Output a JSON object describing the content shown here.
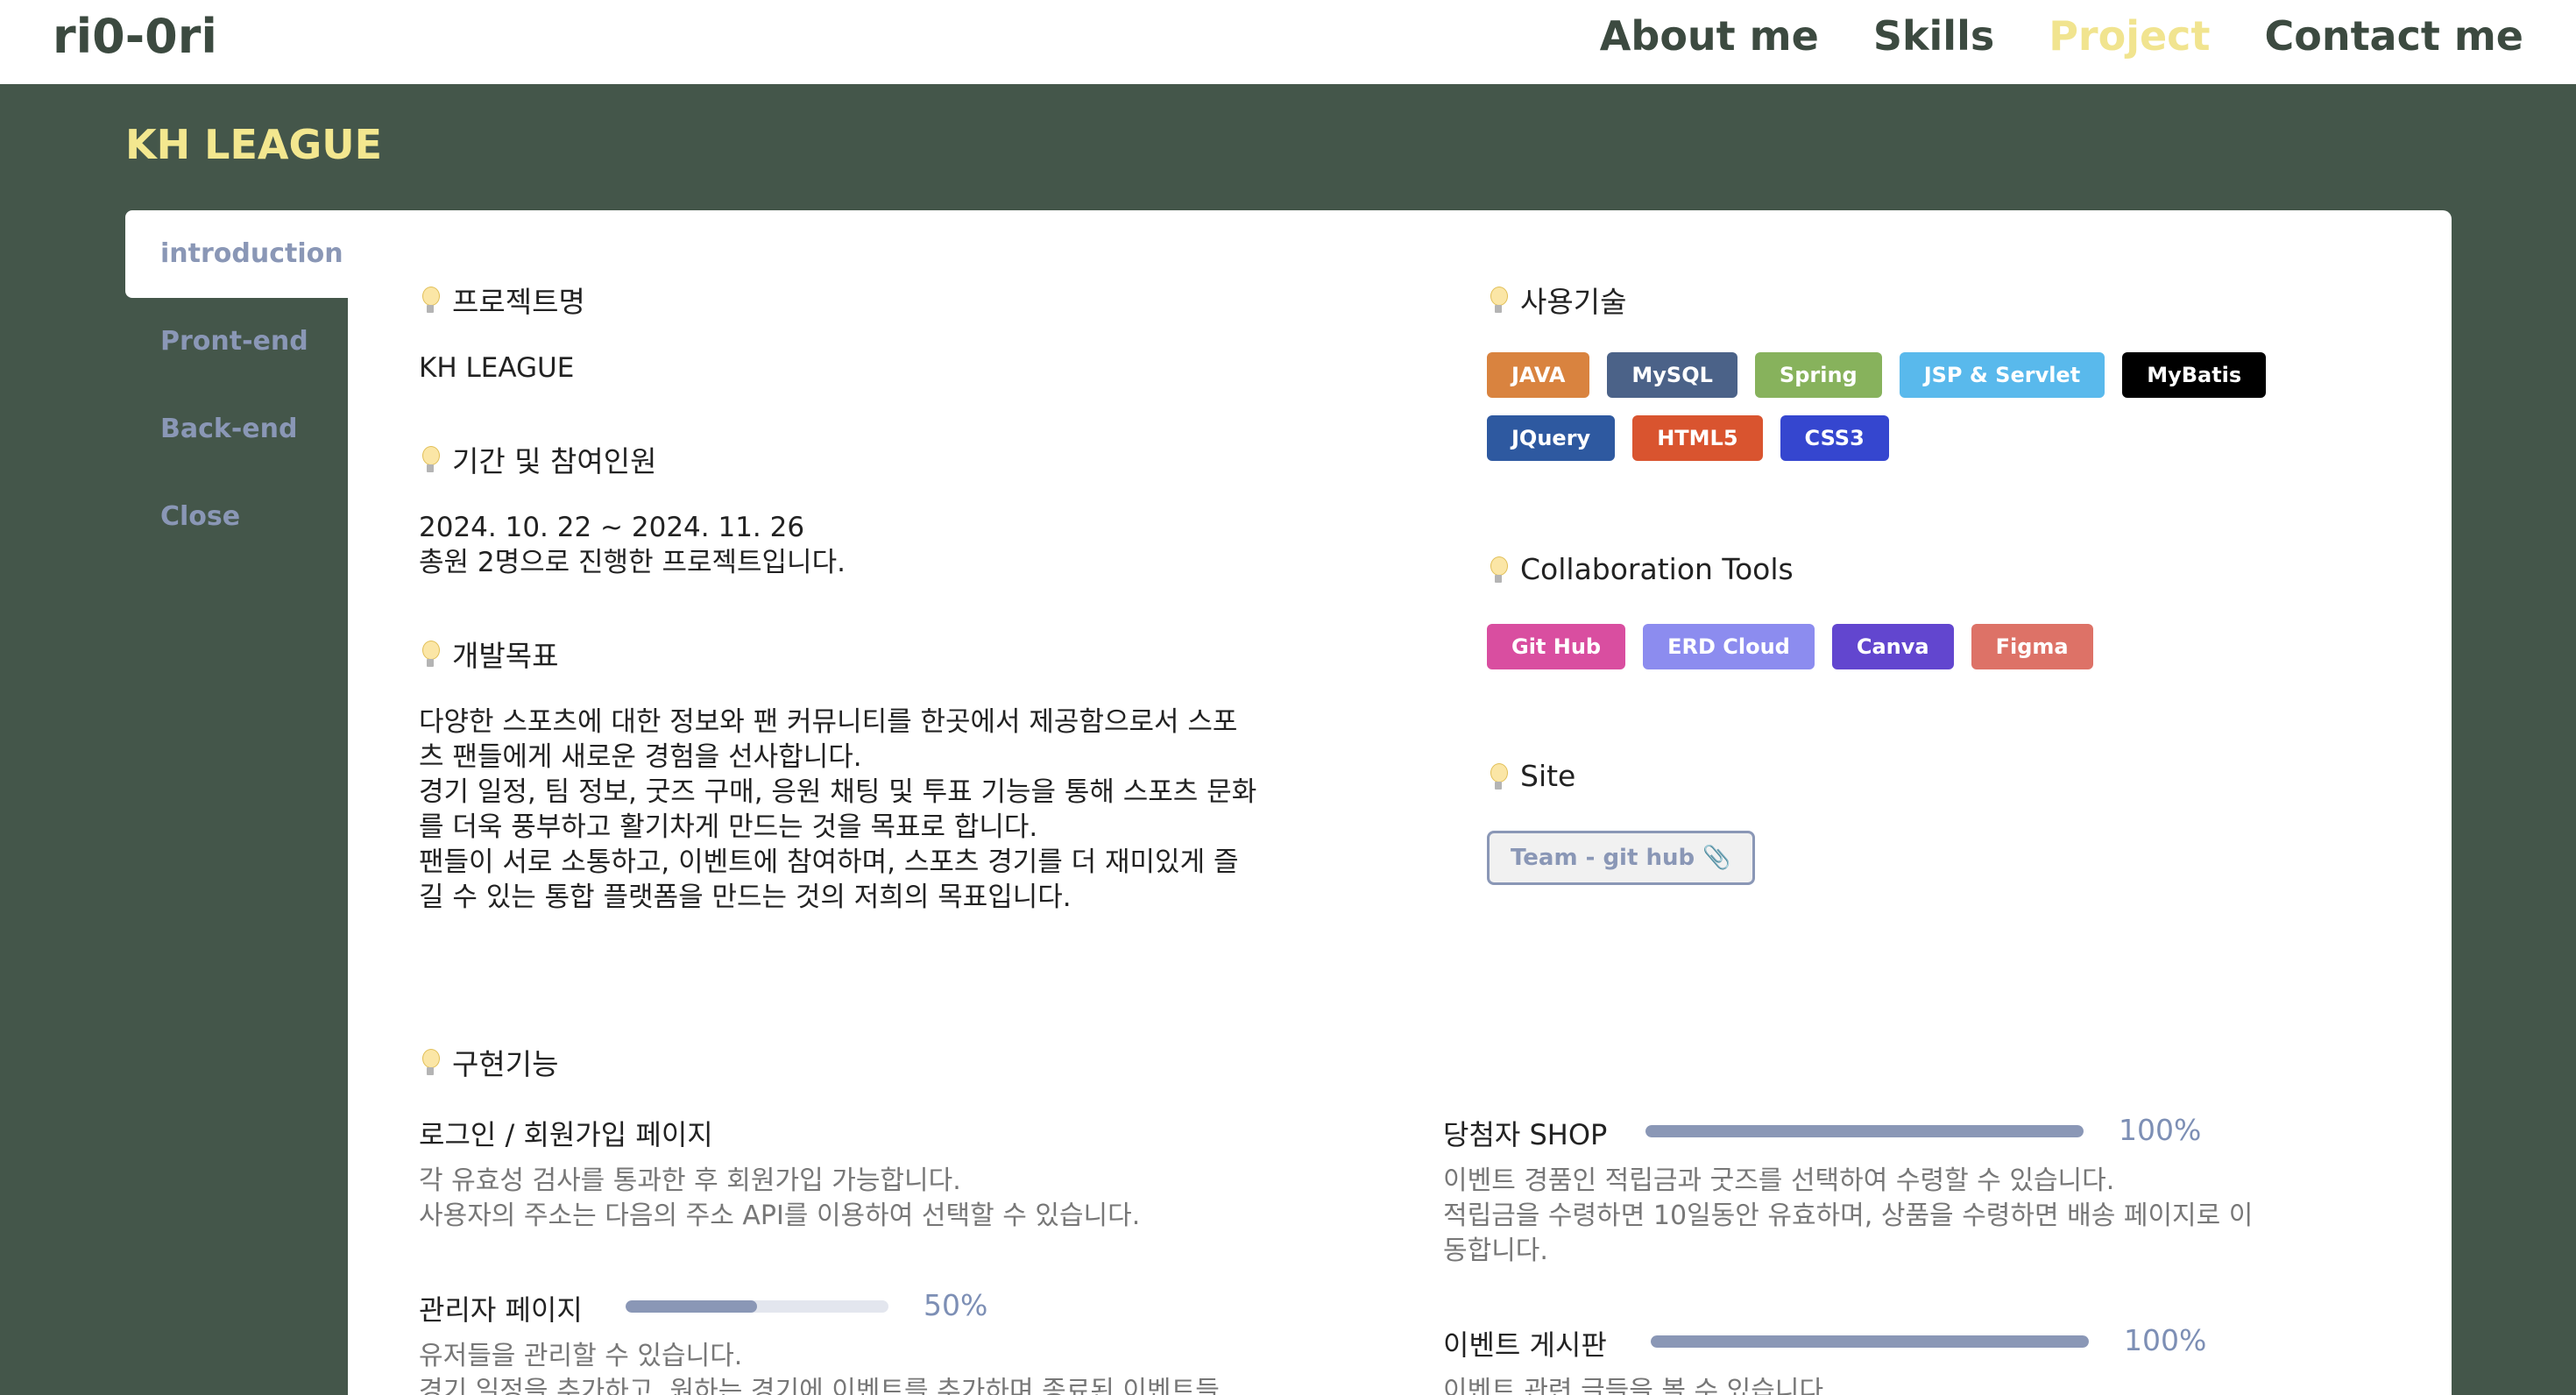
{
  "header": {
    "logo": "ri0-0ri",
    "nav": [
      "About me",
      "Skills",
      "Project",
      "Contact me"
    ],
    "active_nav": "Project"
  },
  "section": {
    "title": "KH LEAGUE"
  },
  "sidebar": {
    "items": [
      "introduction",
      "Pront-end",
      "Back-end",
      "Close"
    ],
    "active": "introduction"
  },
  "intro": {
    "project_name_heading": "프로젝트명",
    "project_name": "KH LEAGUE",
    "period_heading": "기간 및 참여인원",
    "period_text": "2024. 10. 22 ~ 2024. 11. 26\n총원 2명으로 진행한 프로젝트입니다.",
    "goal_heading": "개발목표",
    "goal_text": "다양한 스포츠에 대한 정보와 팬 커뮤니티를 한곳에서 제공함으로서 스포\n츠 팬들에게 새로운 경험을 선사합니다.\n경기 일정, 팀 정보, 굿즈 구매, 응원 채팅 및 투표 기능을 통해 스포츠 문화\n를 더욱 풍부하고 활기차게 만드는 것을 목표로 합니다.\n팬들이 서로 소통하고, 이벤트에 참여하며, 스포츠 경기를 더 재미있게 즐\n길 수 있는 통합 플랫폼을 만드는 것의 저희의 목표입니다."
  },
  "tech": {
    "heading": "사용기술",
    "badges": [
      {
        "label": "JAVA",
        "color": "#d9833f"
      },
      {
        "label": "MySQL",
        "color": "#4b6288"
      },
      {
        "label": "Spring",
        "color": "#87b25c"
      },
      {
        "label": "JSP & Servlet",
        "color": "#59b9ec"
      },
      {
        "label": "MyBatis",
        "color": "#000000"
      },
      {
        "label": "JQuery",
        "color": "#2e59a0"
      },
      {
        "label": "HTML5",
        "color": "#d9542f"
      },
      {
        "label": "CSS3",
        "color": "#3546cf"
      }
    ]
  },
  "collab": {
    "heading": "Collaboration Tools",
    "badges": [
      {
        "label": "Git Hub",
        "color": "#d94ea0"
      },
      {
        "label": "ERD Cloud",
        "color": "#8c8cef"
      },
      {
        "label": "Canva",
        "color": "#6246cf"
      },
      {
        "label": "Figma",
        "color": "#dd7267"
      }
    ]
  },
  "site": {
    "heading": "Site",
    "button_label": "Team - git hub 📎"
  },
  "features": {
    "heading": "구현기능",
    "items": [
      {
        "title": "로그인 / 회원가입 페이지",
        "description": "각 유효성 검사를 통과한 후 회원가입 가능합니다.\n사용자의 주소는 다음의 주소 API를 이용하여 선택할 수 있습니다."
      },
      {
        "title": "당첨자 SHOP",
        "progress": "100%",
        "progress_value": 1.0,
        "description": "이벤트 경품인 적립금과 굿즈를 선택하여 수령할 수 있습니다.\n적립금을 수령하면 10일동안 유효하며, 상품을 수령하면 배송 페이지로 이\n동합니다."
      },
      {
        "title": "관리자 페이지",
        "progress": "50%",
        "progress_value": 0.5,
        "description": "유저들을 관리할 수 있습니다.\n경기 일정을 추가하고, 원하는 경기에 이벤트를 추가하며 종료된 이벤트들"
      },
      {
        "title": "이벤트 게시판",
        "progress": "100%",
        "progress_value": 1.0,
        "description": "이벤트 관련 글들을 볼 수 있습니다."
      }
    ]
  }
}
